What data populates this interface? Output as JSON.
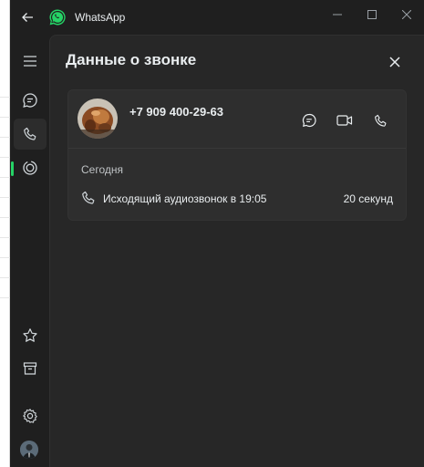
{
  "app": {
    "title": "WhatsApp"
  },
  "panel": {
    "title": "Данные о звонке"
  },
  "contact": {
    "name": "+7 909 400-29-63"
  },
  "call_log": {
    "day": "Сегодня",
    "entries": [
      {
        "description": "Исходящий аудиозвонок в 19:05",
        "duration": "20 секунд"
      }
    ]
  },
  "colors": {
    "accent": "#25d366",
    "background": "#1f1f1f",
    "panel": "#272727",
    "card": "#2e2e2e"
  },
  "icons": {
    "titlebar": [
      "back-arrow-icon",
      "whatsapp-logo-icon",
      "minimize-icon",
      "maximize-icon",
      "close-icon"
    ],
    "sidebar": [
      "menu-icon",
      "chats-icon",
      "calls-icon",
      "status-icon",
      "starred-icon",
      "archive-icon",
      "settings-icon"
    ],
    "card_actions": [
      "message-icon",
      "video-call-icon",
      "voice-call-icon"
    ]
  }
}
